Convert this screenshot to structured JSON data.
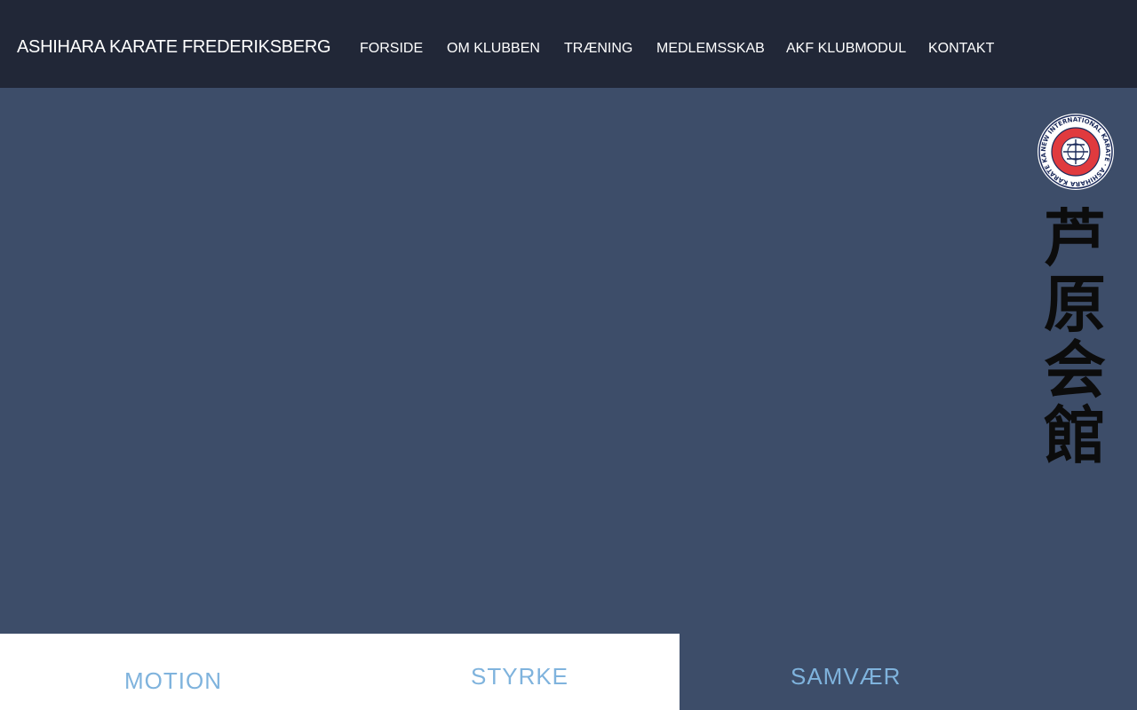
{
  "header": {
    "site_title": "ASHIHARA KARATE FREDERIKSBERG",
    "nav": [
      {
        "label": "FORSIDE"
      },
      {
        "label": "OM KLUBBEN"
      },
      {
        "label": "TRÆNING"
      },
      {
        "label": "MEDLEMSSKAB"
      },
      {
        "label": "AKF KLUBMODUL"
      },
      {
        "label": "KONTAKT"
      }
    ]
  },
  "hero": {
    "logo_text": "NEW INTERNATIONAL KARATE · ASHIHARA KARATE KAIKAN ·",
    "kanji": [
      "芦",
      "原",
      "会",
      "館"
    ]
  },
  "features": [
    {
      "title": "MOTION"
    },
    {
      "title": "STYRKE"
    },
    {
      "title": "SAMVÆR"
    }
  ],
  "colors": {
    "header_bg": "#212737",
    "hero_bg": "#3d4d69",
    "accent": "#7fb3dd",
    "logo_red": "#e03a3e"
  }
}
